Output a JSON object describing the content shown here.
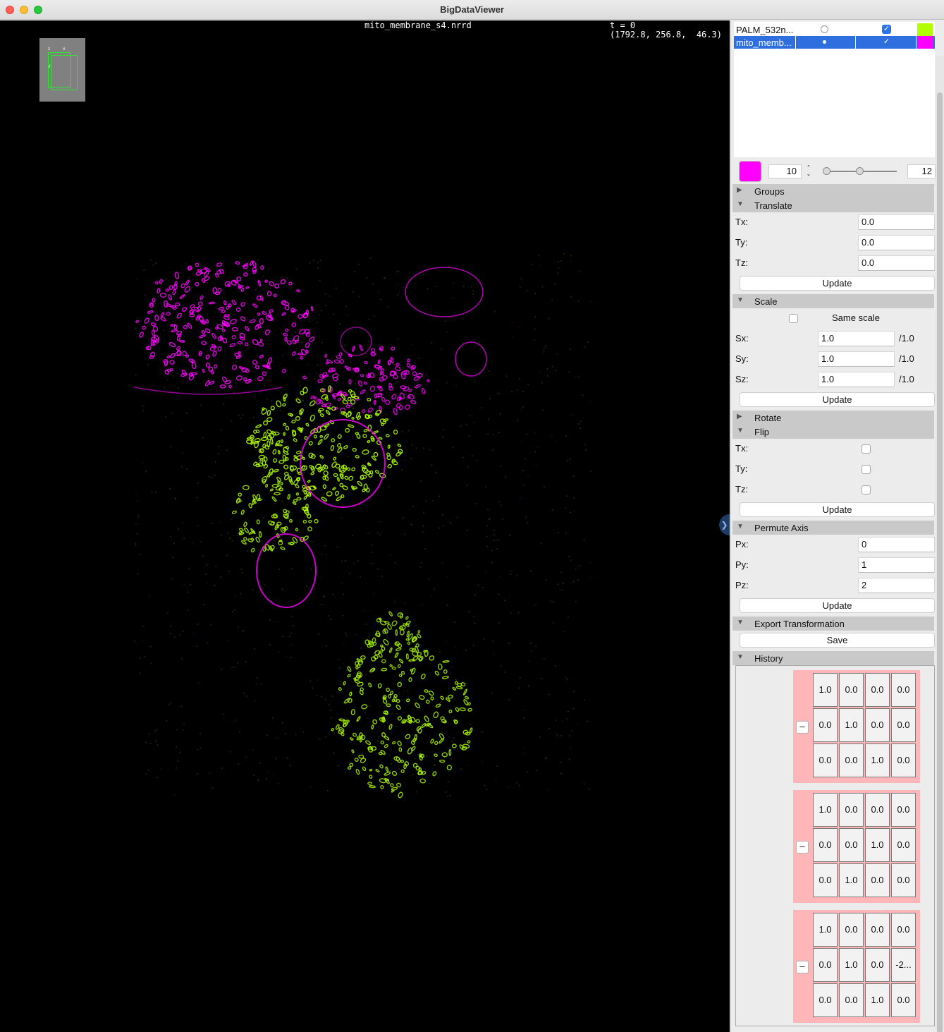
{
  "window": {
    "title": "BigDataViewer"
  },
  "viewer": {
    "source_name": "mito_membrane_s4.nrrd",
    "time_label": "t = 0",
    "coords": "(1792.8, 256.8,  46.3)",
    "nav_axes": {
      "z": "z",
      "x": "x",
      "y": "y"
    }
  },
  "sources": [
    {
      "name": "PALM_532n...",
      "current": false,
      "visible": true,
      "color": "#b2ff00",
      "selected": false
    },
    {
      "name": "mito_memb...",
      "current": true,
      "visible": true,
      "color": "#ff00ff",
      "selected": true
    }
  ],
  "display": {
    "color": "#ff00ff",
    "min": "10",
    "max": "12",
    "slider_min_fraction": 0.0,
    "slider_max_fraction": 0.47
  },
  "sections": {
    "groups": "Groups",
    "translate": "Translate",
    "scale": "Scale",
    "rotate": "Rotate",
    "flip": "Flip",
    "permute": "Permute Axis",
    "export": "Export Transformation",
    "history": "History"
  },
  "translate": {
    "tx_label": "Tx:",
    "ty_label": "Ty:",
    "tz_label": "Tz:",
    "tx": "0.0",
    "ty": "0.0",
    "tz": "0.0",
    "update": "Update"
  },
  "scale": {
    "same_label": "Same scale",
    "sx_label": "Sx:",
    "sy_label": "Sy:",
    "sz_label": "Sz:",
    "sx": "1.0",
    "sy": "1.0",
    "sz": "1.0",
    "sx_div": "/1.0",
    "sy_div": "/1.0",
    "sz_div": "/1.0",
    "update": "Update"
  },
  "flip": {
    "tx_label": "Tx:",
    "ty_label": "Ty:",
    "tz_label": "Tz:",
    "update": "Update"
  },
  "permute": {
    "px_label": "Px:",
    "py_label": "Py:",
    "pz_label": "Pz:",
    "px": "0",
    "py": "1",
    "pz": "2",
    "update": "Update"
  },
  "export": {
    "save": "Save"
  },
  "history": {
    "remove_label": "–",
    "entries": [
      {
        "matrix": [
          [
            "1.0",
            "0.0",
            "0.0",
            "0.0"
          ],
          [
            "0.0",
            "1.0",
            "0.0",
            "0.0"
          ],
          [
            "0.0",
            "0.0",
            "1.0",
            "0.0"
          ]
        ]
      },
      {
        "matrix": [
          [
            "1.0",
            "0.0",
            "0.0",
            "0.0"
          ],
          [
            "0.0",
            "0.0",
            "1.0",
            "0.0"
          ],
          [
            "0.0",
            "1.0",
            "0.0",
            "0.0"
          ]
        ]
      },
      {
        "matrix": [
          [
            "1.0",
            "0.0",
            "0.0",
            "0.0"
          ],
          [
            "0.0",
            "1.0",
            "0.0",
            "-2..."
          ],
          [
            "0.0",
            "0.0",
            "1.0",
            "0.0"
          ]
        ]
      }
    ]
  }
}
